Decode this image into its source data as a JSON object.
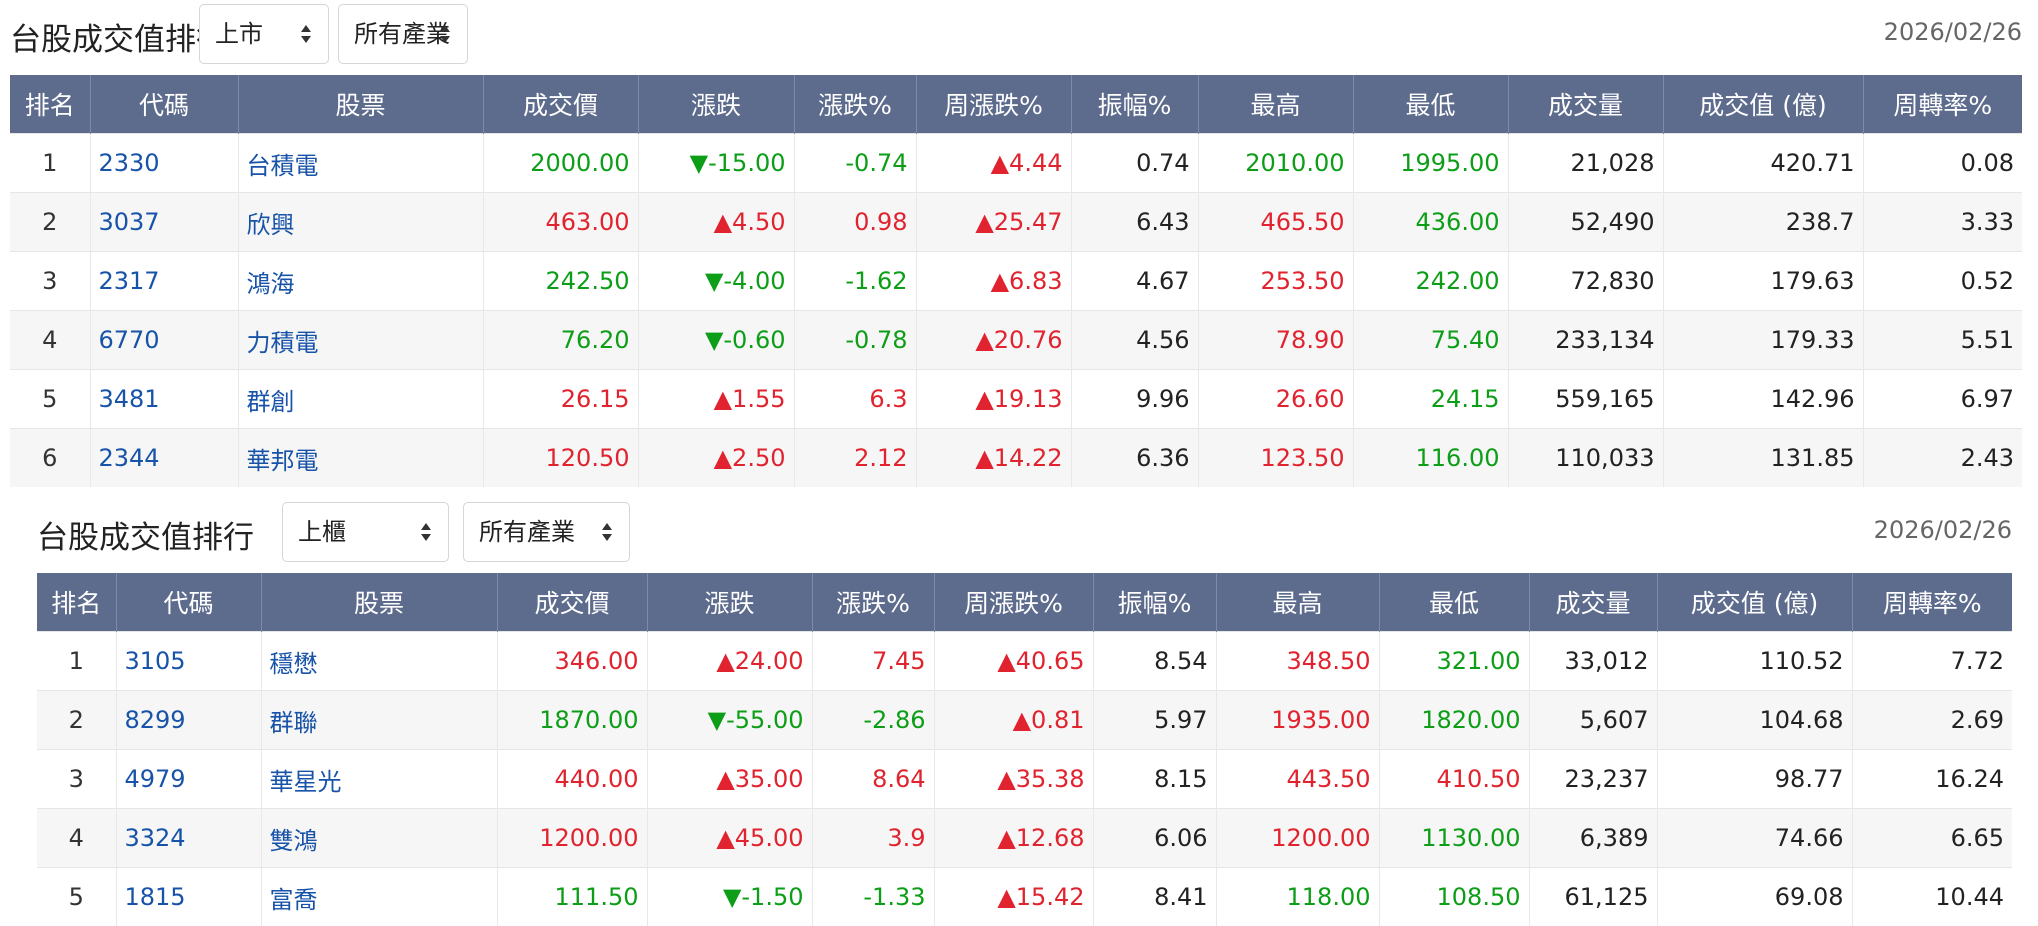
{
  "headers": [
    "排名",
    "代碼",
    "股票",
    "成交價",
    "漲跌",
    "漲跌%",
    "周漲跌%",
    "振幅%",
    "最高",
    "最低",
    "成交量",
    "成交值 (億)",
    "周轉率%"
  ],
  "colors": {
    "up": "#e0232e",
    "down": "#0d9e17",
    "link": "#1753a8",
    "header_bg": "#5d6b8c"
  },
  "icons": {
    "select_arrow": "sort-arrows-icon"
  },
  "sections": [
    {
      "title": "台股成交值排行",
      "market_select": "上市",
      "industry_select": "所有產業",
      "date": "2026/02/26",
      "rows": [
        {
          "rank": "1",
          "code": "2330",
          "name": "台積電",
          "price": "2000.00",
          "change": "▼-15.00",
          "change_pct": "-0.74",
          "week_pct": "▲4.44",
          "amplitude": "0.74",
          "high": "2010.00",
          "low": "1995.00",
          "volume": "21,028",
          "value": "420.71",
          "turnover": "0.08",
          "color": {
            "price": "down",
            "change": "down",
            "change_pct": "down",
            "week_pct": "up",
            "high": "down",
            "low": "down"
          }
        },
        {
          "rank": "2",
          "code": "3037",
          "name": "欣興",
          "price": "463.00",
          "change": "▲4.50",
          "change_pct": "0.98",
          "week_pct": "▲25.47",
          "amplitude": "6.43",
          "high": "465.50",
          "low": "436.00",
          "volume": "52,490",
          "value": "238.7",
          "turnover": "3.33",
          "color": {
            "price": "up",
            "change": "up",
            "change_pct": "up",
            "week_pct": "up",
            "high": "up",
            "low": "down"
          }
        },
        {
          "rank": "3",
          "code": "2317",
          "name": "鴻海",
          "price": "242.50",
          "change": "▼-4.00",
          "change_pct": "-1.62",
          "week_pct": "▲6.83",
          "amplitude": "4.67",
          "high": "253.50",
          "low": "242.00",
          "volume": "72,830",
          "value": "179.63",
          "turnover": "0.52",
          "color": {
            "price": "down",
            "change": "down",
            "change_pct": "down",
            "week_pct": "up",
            "high": "up",
            "low": "down"
          }
        },
        {
          "rank": "4",
          "code": "6770",
          "name": "力積電",
          "price": "76.20",
          "change": "▼-0.60",
          "change_pct": "-0.78",
          "week_pct": "▲20.76",
          "amplitude": "4.56",
          "high": "78.90",
          "low": "75.40",
          "volume": "233,134",
          "value": "179.33",
          "turnover": "5.51",
          "color": {
            "price": "down",
            "change": "down",
            "change_pct": "down",
            "week_pct": "up",
            "high": "up",
            "low": "down"
          }
        },
        {
          "rank": "5",
          "code": "3481",
          "name": "群創",
          "price": "26.15",
          "change": "▲1.55",
          "change_pct": "6.3",
          "week_pct": "▲19.13",
          "amplitude": "9.96",
          "high": "26.60",
          "low": "24.15",
          "volume": "559,165",
          "value": "142.96",
          "turnover": "6.97",
          "color": {
            "price": "up",
            "change": "up",
            "change_pct": "up",
            "week_pct": "up",
            "high": "up",
            "low": "down"
          }
        },
        {
          "rank": "6",
          "code": "2344",
          "name": "華邦電",
          "price": "120.50",
          "change": "▲2.50",
          "change_pct": "2.12",
          "week_pct": "▲14.22",
          "amplitude": "6.36",
          "high": "123.50",
          "low": "116.00",
          "volume": "110,033",
          "value": "131.85",
          "turnover": "2.43",
          "color": {
            "price": "up",
            "change": "up",
            "change_pct": "up",
            "week_pct": "up",
            "high": "up",
            "low": "down"
          }
        }
      ]
    },
    {
      "title": "台股成交值排行",
      "market_select": "上櫃",
      "industry_select": "所有產業",
      "date": "2026/02/26",
      "rows": [
        {
          "rank": "1",
          "code": "3105",
          "name": "穩懋",
          "price": "346.00",
          "change": "▲24.00",
          "change_pct": "7.45",
          "week_pct": "▲40.65",
          "amplitude": "8.54",
          "high": "348.50",
          "low": "321.00",
          "volume": "33,012",
          "value": "110.52",
          "turnover": "7.72",
          "color": {
            "price": "up",
            "change": "up",
            "change_pct": "up",
            "week_pct": "up",
            "high": "up",
            "low": "down"
          }
        },
        {
          "rank": "2",
          "code": "8299",
          "name": "群聯",
          "price": "1870.00",
          "change": "▼-55.00",
          "change_pct": "-2.86",
          "week_pct": "▲0.81",
          "amplitude": "5.97",
          "high": "1935.00",
          "low": "1820.00",
          "volume": "5,607",
          "value": "104.68",
          "turnover": "2.69",
          "color": {
            "price": "down",
            "change": "down",
            "change_pct": "down",
            "week_pct": "up",
            "high": "up",
            "low": "down"
          }
        },
        {
          "rank": "3",
          "code": "4979",
          "name": "華星光",
          "price": "440.00",
          "change": "▲35.00",
          "change_pct": "8.64",
          "week_pct": "▲35.38",
          "amplitude": "8.15",
          "high": "443.50",
          "low": "410.50",
          "volume": "23,237",
          "value": "98.77",
          "turnover": "16.24",
          "color": {
            "price": "up",
            "change": "up",
            "change_pct": "up",
            "week_pct": "up",
            "high": "up",
            "low": "up"
          }
        },
        {
          "rank": "4",
          "code": "3324",
          "name": "雙鴻",
          "price": "1200.00",
          "change": "▲45.00",
          "change_pct": "3.9",
          "week_pct": "▲12.68",
          "amplitude": "6.06",
          "high": "1200.00",
          "low": "1130.00",
          "volume": "6,389",
          "value": "74.66",
          "turnover": "6.65",
          "color": {
            "price": "up",
            "change": "up",
            "change_pct": "up",
            "week_pct": "up",
            "high": "up",
            "low": "down"
          }
        },
        {
          "rank": "5",
          "code": "1815",
          "name": "富喬",
          "price": "111.50",
          "change": "▼-1.50",
          "change_pct": "-1.33",
          "week_pct": "▲15.42",
          "amplitude": "8.41",
          "high": "118.00",
          "low": "108.50",
          "volume": "61,125",
          "value": "69.08",
          "turnover": "10.44",
          "color": {
            "price": "down",
            "change": "down",
            "change_pct": "down",
            "week_pct": "up",
            "high": "down",
            "low": "down"
          }
        }
      ]
    }
  ]
}
